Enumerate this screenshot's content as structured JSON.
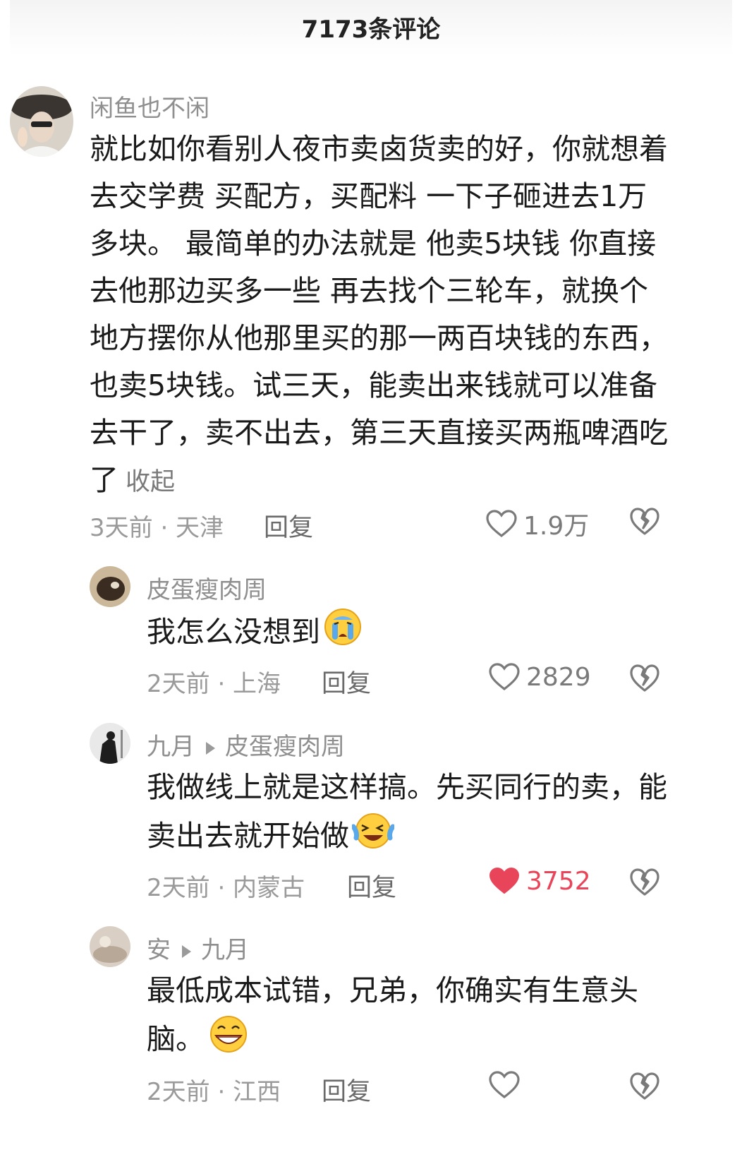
{
  "header": {
    "title": "7173条评论"
  },
  "comments": [
    {
      "username": "闲鱼也不闲",
      "text": "就比如你看别人夜市卖卤货卖的好，你就想着去交学费 买配方，买配料 一下子砸进去1万多块。 最简单的办法就是 他卖5块钱 你直接去他那边买多一些 再去找个三轮车，就换个地方摆你从他那里买的那一两百块钱的东西，也卖5块钱。试三天，能卖出来钱就可以准备去干了，卖不出去，第三天直接买两瓶啤酒吃了",
      "collapse": "收起",
      "meta": "3天前 · 天津",
      "reply": "回复",
      "likes": "1.9万"
    },
    {
      "username": "皮蛋瘦肉周",
      "text": "我怎么没想到",
      "emoji": "crying-face-emoji",
      "meta": "2天前 · 上海",
      "reply": "回复",
      "likes": "2829"
    },
    {
      "username": "九月",
      "reply_to": "皮蛋瘦肉周",
      "text": "我做线上就是这样搞。先买同行的卖，能卖出去就开始做",
      "emoji": "laughing-tears-emoji",
      "meta": "2天前 · 内蒙古",
      "reply": "回复",
      "likes": "3752",
      "liked": true
    },
    {
      "username": "安",
      "reply_to": "九月",
      "text": "最低成本试错，兄弟，你确实有生意头脑。",
      "emoji": "grinning-face-emoji",
      "meta": "2天前 · 江西",
      "reply": "回复"
    }
  ],
  "colors": {
    "liked": "#e8455a",
    "muted": "#9a9a9a",
    "text": "#1a1a1a"
  }
}
